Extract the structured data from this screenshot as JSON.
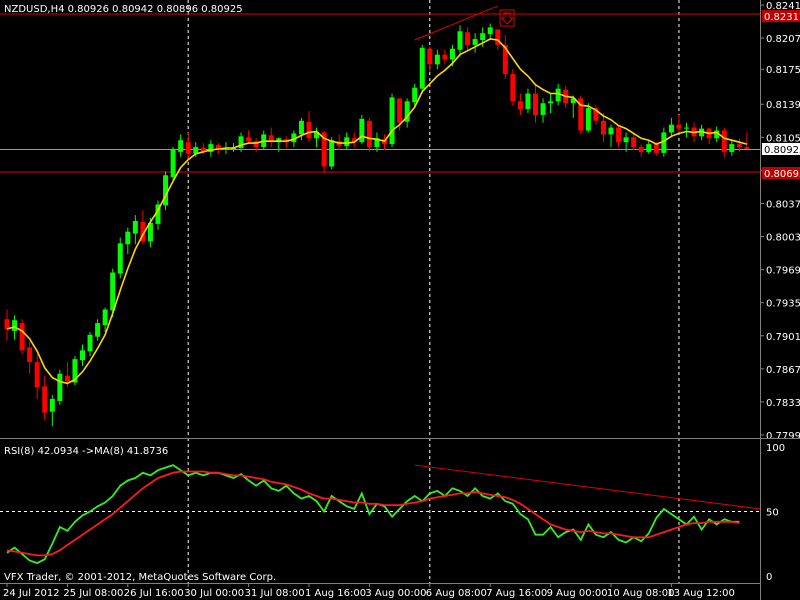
{
  "header": {
    "symbol_line": "NZDUSD,H4  0.80926 0.80942 0.80896 0.80925"
  },
  "price_axis": {
    "labels": [
      "0.82410",
      "0.82070",
      "0.81750",
      "0.81390",
      "0.81050",
      "0.80710",
      "0.80370",
      "0.80030",
      "0.79690",
      "0.79350",
      "0.79010",
      "0.78670",
      "0.78330",
      "0.77990"
    ]
  },
  "tags": {
    "current_price": "0.80925",
    "upper_level": "0.82317",
    "lower_level": "0.80693"
  },
  "rsi_panel": {
    "header": "RSI(8) 42.0934  ->MA(8) 41.8736",
    "levels": [
      "100",
      "50",
      "0"
    ]
  },
  "time_axis": {
    "labels": [
      "24 Jul 2012",
      "25 Jul 08:00",
      "26 Jul 16:00",
      "30 Jul 00:00",
      "31 Jul 08:00",
      "1 Aug 16:00",
      "3 Aug 00:00",
      "6 Aug 08:00",
      "7 Aug 16:00",
      "9 Aug 00:00",
      "10 Aug 08:00",
      "13 Aug 12:00"
    ]
  },
  "footer": {
    "copyright": "VFX Trader, © 2001-2012, MetaQuotes Software Corp."
  },
  "colors": {
    "background": "#000000",
    "bull_candle": "#00ff00",
    "bear_candle": "#ff0000",
    "moving_average": "#ffd700",
    "rsi_line": "#33ee22",
    "rsi_ma": "#ff1a1a",
    "level_line": "#e00000",
    "grid": "#ffffff",
    "axis_text": "#ffffff"
  },
  "icons": {
    "sell_arrow": "down-arrow-signal-icon"
  },
  "chart_data": [
    {
      "type": "candlestick",
      "title": "NZDUSD,H4",
      "ylim": [
        0.7799,
        0.8241
      ],
      "series": [
        {
          "name": "NZDUSD",
          "ohlc": [
            [
              0.7918,
              0.7928,
              0.7896,
              0.7908
            ],
            [
              0.7906,
              0.7922,
              0.7897,
              0.7917
            ],
            [
              0.7914,
              0.7918,
              0.7882,
              0.7886
            ],
            [
              0.7889,
              0.7895,
              0.7862,
              0.7874
            ],
            [
              0.7874,
              0.7882,
              0.7836,
              0.7848
            ],
            [
              0.7849,
              0.786,
              0.7814,
              0.7822
            ],
            [
              0.7823,
              0.784,
              0.7808,
              0.7836
            ],
            [
              0.7834,
              0.7866,
              0.783,
              0.7862
            ],
            [
              0.786,
              0.7874,
              0.7848,
              0.7854
            ],
            [
              0.7853,
              0.788,
              0.785,
              0.7877
            ],
            [
              0.7876,
              0.7892,
              0.787,
              0.7886
            ],
            [
              0.7885,
              0.7905,
              0.788,
              0.7902
            ],
            [
              0.79,
              0.7918,
              0.7896,
              0.7914
            ],
            [
              0.7912,
              0.793,
              0.7905,
              0.7928
            ],
            [
              0.7927,
              0.797,
              0.792,
              0.7966
            ],
            [
              0.7965,
              0.8002,
              0.796,
              0.7996
            ],
            [
              0.7995,
              0.8012,
              0.7985,
              0.8008
            ],
            [
              0.8006,
              0.8025,
              0.7995,
              0.8019
            ],
            [
              0.8018,
              0.803,
              0.7995,
              0.7998
            ],
            [
              0.7998,
              0.8022,
              0.7992,
              0.8017
            ],
            [
              0.8016,
              0.804,
              0.801,
              0.8036
            ],
            [
              0.8035,
              0.807,
              0.803,
              0.8066
            ],
            [
              0.8064,
              0.8095,
              0.806,
              0.8092
            ],
            [
              0.809,
              0.8108,
              0.8085,
              0.8102
            ],
            [
              0.81,
              0.811,
              0.8082,
              0.8088
            ],
            [
              0.8088,
              0.81,
              0.8085,
              0.8095
            ],
            [
              0.8094,
              0.8099,
              0.8088,
              0.809
            ],
            [
              0.809,
              0.8102,
              0.8085,
              0.8098
            ],
            [
              0.8097,
              0.8099,
              0.8088,
              0.8092
            ],
            [
              0.8092,
              0.81,
              0.8088,
              0.8094
            ],
            [
              0.8094,
              0.8099,
              0.809,
              0.8094
            ],
            [
              0.8094,
              0.811,
              0.809,
              0.8106
            ],
            [
              0.8105,
              0.8112,
              0.8098,
              0.8101
            ],
            [
              0.8101,
              0.8104,
              0.809,
              0.8095
            ],
            [
              0.8095,
              0.8112,
              0.8092,
              0.8108
            ],
            [
              0.8107,
              0.8115,
              0.8095,
              0.81
            ],
            [
              0.81,
              0.8105,
              0.809,
              0.8104
            ],
            [
              0.8103,
              0.8106,
              0.8094,
              0.81
            ],
            [
              0.81,
              0.8112,
              0.8095,
              0.8109
            ],
            [
              0.8108,
              0.8125,
              0.8102,
              0.8122
            ],
            [
              0.8121,
              0.8132,
              0.81,
              0.8104
            ],
            [
              0.8104,
              0.8115,
              0.8095,
              0.811
            ],
            [
              0.811,
              0.8112,
              0.8068,
              0.8075
            ],
            [
              0.8075,
              0.8105,
              0.8072,
              0.8102
            ],
            [
              0.8101,
              0.8108,
              0.8092,
              0.8096
            ],
            [
              0.8096,
              0.811,
              0.8092,
              0.8105
            ],
            [
              0.8104,
              0.811,
              0.8095,
              0.81
            ],
            [
              0.81,
              0.8128,
              0.8098,
              0.8124
            ],
            [
              0.8122,
              0.8125,
              0.809,
              0.8095
            ],
            [
              0.8095,
              0.811,
              0.809,
              0.8104
            ],
            [
              0.8103,
              0.8108,
              0.8092,
              0.8098
            ],
            [
              0.8098,
              0.815,
              0.8095,
              0.8146
            ],
            [
              0.8145,
              0.8132,
              0.8112,
              0.812
            ],
            [
              0.8121,
              0.8145,
              0.8115,
              0.8142
            ],
            [
              0.8141,
              0.816,
              0.8135,
              0.8156
            ],
            [
              0.8155,
              0.82,
              0.815,
              0.8197
            ],
            [
              0.8196,
              0.8198,
              0.8172,
              0.818
            ],
            [
              0.818,
              0.8195,
              0.8175,
              0.819
            ],
            [
              0.819,
              0.8195,
              0.818,
              0.8185
            ],
            [
              0.8185,
              0.82,
              0.8178,
              0.8196
            ],
            [
              0.8195,
              0.822,
              0.8188,
              0.8214
            ],
            [
              0.8213,
              0.8218,
              0.8195,
              0.82
            ],
            [
              0.82,
              0.8212,
              0.8192,
              0.8206
            ],
            [
              0.8205,
              0.8218,
              0.8198,
              0.8212
            ],
            [
              0.8211,
              0.8222,
              0.8205,
              0.8218
            ],
            [
              0.8216,
              0.8215,
              0.8195,
              0.82
            ],
            [
              0.82,
              0.821,
              0.8165,
              0.817
            ],
            [
              0.817,
              0.8175,
              0.8138,
              0.8142
            ],
            [
              0.8142,
              0.815,
              0.8128,
              0.8134
            ],
            [
              0.8134,
              0.8155,
              0.813,
              0.815
            ],
            [
              0.815,
              0.8158,
              0.812,
              0.8128
            ],
            [
              0.8128,
              0.8145,
              0.812,
              0.814
            ],
            [
              0.814,
              0.815,
              0.813,
              0.8142
            ],
            [
              0.8142,
              0.816,
              0.8138,
              0.8155
            ],
            [
              0.8154,
              0.8158,
              0.8135,
              0.814
            ],
            [
              0.814,
              0.8148,
              0.8125,
              0.8145
            ],
            [
              0.8145,
              0.8148,
              0.8108,
              0.8112
            ],
            [
              0.8112,
              0.814,
              0.811,
              0.8135
            ],
            [
              0.8135,
              0.8138,
              0.8118,
              0.8122
            ],
            [
              0.8122,
              0.813,
              0.81,
              0.8108
            ],
            [
              0.8108,
              0.8118,
              0.8095,
              0.8115
            ],
            [
              0.8115,
              0.8118,
              0.8095,
              0.81
            ],
            [
              0.81,
              0.811,
              0.809,
              0.8105
            ],
            [
              0.8105,
              0.8108,
              0.8092,
              0.8095
            ],
            [
              0.8095,
              0.8098,
              0.8085,
              0.809
            ],
            [
              0.809,
              0.8102,
              0.8088,
              0.8098
            ],
            [
              0.8098,
              0.81,
              0.8086,
              0.8089
            ],
            [
              0.8089,
              0.8115,
              0.8085,
              0.811
            ],
            [
              0.811,
              0.8125,
              0.8105,
              0.8118
            ],
            [
              0.8118,
              0.8128,
              0.811,
              0.8114
            ],
            [
              0.8114,
              0.812,
              0.8105,
              0.8115
            ],
            [
              0.8115,
              0.812,
              0.81,
              0.8106
            ],
            [
              0.8106,
              0.8118,
              0.8102,
              0.8114
            ],
            [
              0.8114,
              0.8115,
              0.8098,
              0.8104
            ],
            [
              0.8104,
              0.8116,
              0.81,
              0.8112
            ],
            [
              0.8112,
              0.8115,
              0.8084,
              0.809
            ],
            [
              0.809,
              0.8102,
              0.8086,
              0.8098
            ],
            [
              0.8098,
              0.8104,
              0.809,
              0.8095
            ],
            [
              0.8095,
              0.811,
              0.8093,
              0.8093
            ]
          ]
        },
        {
          "name": "MA",
          "values": [
            0.7908,
            0.791,
            0.7906,
            0.7898,
            0.7885,
            0.7868,
            0.7858,
            0.7854,
            0.7852,
            0.7856,
            0.7864,
            0.7875,
            0.7888,
            0.7902,
            0.7924,
            0.7948,
            0.797,
            0.799,
            0.8005,
            0.8018,
            0.803,
            0.8045,
            0.806,
            0.8074,
            0.8082,
            0.8088,
            0.809,
            0.8092,
            0.8093,
            0.8094,
            0.8094,
            0.8097,
            0.8099,
            0.8099,
            0.8101,
            0.8101,
            0.8101,
            0.8101,
            0.8103,
            0.8107,
            0.811,
            0.8111,
            0.8104,
            0.8101,
            0.8099,
            0.8099,
            0.81,
            0.8106,
            0.8104,
            0.8103,
            0.8101,
            0.8112,
            0.8118,
            0.8126,
            0.8136,
            0.8152,
            0.816,
            0.8168,
            0.8174,
            0.8181,
            0.819,
            0.8194,
            0.8198,
            0.8202,
            0.8206,
            0.8205,
            0.8197,
            0.8186,
            0.8175,
            0.8168,
            0.8159,
            0.8154,
            0.815,
            0.815,
            0.8147,
            0.8146,
            0.8138,
            0.8137,
            0.8133,
            0.8127,
            0.8123,
            0.8117,
            0.8114,
            0.8109,
            0.8104,
            0.8102,
            0.8098,
            0.8101,
            0.8106,
            0.8109,
            0.8111,
            0.811,
            0.8111,
            0.8109,
            0.811,
            0.8104,
            0.8102,
            0.81,
            0.8098
          ]
        }
      ],
      "horizontal_levels": [
        0.82317,
        0.80693
      ],
      "current_price": 0.80925
    },
    {
      "type": "line",
      "title": "RSI(8)",
      "ylim": [
        0,
        100
      ],
      "series": [
        {
          "name": "RSI(8)",
          "values": [
            18,
            22,
            17,
            12,
            10,
            13,
            25,
            38,
            35,
            42,
            47,
            50,
            54,
            57,
            62,
            70,
            74,
            76,
            80,
            78,
            82,
            84,
            86,
            82,
            78,
            80,
            78,
            80,
            80,
            78,
            76,
            79,
            74,
            70,
            74,
            68,
            66,
            70,
            64,
            60,
            62,
            58,
            50,
            62,
            58,
            54,
            52,
            64,
            48,
            56,
            54,
            46,
            52,
            58,
            62,
            58,
            64,
            66,
            62,
            68,
            66,
            62,
            68,
            62,
            60,
            64,
            58,
            56,
            48,
            44,
            32,
            32,
            38,
            30,
            34,
            36,
            28,
            40,
            32,
            30,
            34,
            28,
            26,
            30,
            27,
            33,
            45,
            52,
            48,
            44,
            40,
            46,
            36,
            44,
            40,
            44,
            42,
            42
          ]
        },
        {
          "name": "MA(8)",
          "values": [
            20,
            19,
            18,
            17,
            16,
            16,
            17,
            20,
            24,
            28,
            32,
            36,
            40,
            44,
            48,
            53,
            58,
            63,
            68,
            72,
            76,
            78,
            80,
            81,
            81,
            81,
            81,
            80,
            80,
            79,
            78,
            78,
            77,
            76,
            75,
            73,
            72,
            71,
            69,
            67,
            64,
            62,
            60,
            60,
            59,
            58,
            57,
            57,
            56,
            56,
            55,
            55,
            55,
            56,
            57,
            58,
            60,
            61,
            62,
            63,
            64,
            64,
            65,
            64,
            63,
            62,
            61,
            59,
            56,
            52,
            48,
            44,
            40,
            38,
            36,
            35,
            34,
            35,
            34,
            33,
            33,
            32,
            31,
            30,
            30,
            30,
            32,
            34,
            36,
            38,
            40,
            41,
            41,
            42,
            42,
            42,
            42,
            41
          ]
        }
      ],
      "levels": [
        100,
        50,
        0
      ]
    }
  ]
}
